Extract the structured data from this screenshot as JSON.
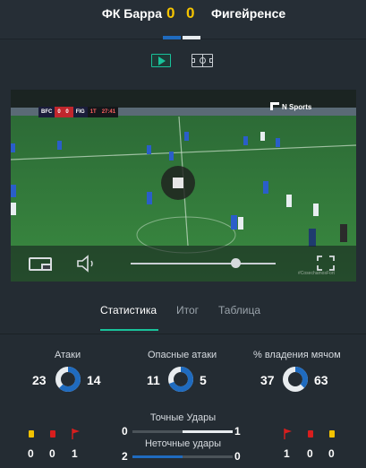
{
  "match": {
    "home_team": "ФК Барра",
    "away_team": "Фигейренсе",
    "home_score": "0",
    "away_score": "0"
  },
  "view_toggle": {
    "video_icon": "play-icon",
    "field_icon": "pitch-icon",
    "selected": "video"
  },
  "video": {
    "scoreboard": {
      "home_abbr": "BFC",
      "score": "0 0",
      "away_abbr": "FIG",
      "period": "1T",
      "clock": "27:41"
    },
    "broadcaster": "N Sports",
    "watermark": "#CosechamosFort",
    "state": "playing",
    "seek_progress": 0.72
  },
  "tabs": [
    {
      "label": "Статистика",
      "active": true
    },
    {
      "label": "Итог",
      "active": false
    },
    {
      "label": "Таблица",
      "active": false
    }
  ],
  "stats": {
    "attacks": {
      "label": "Атаки",
      "home": "23",
      "away": "14"
    },
    "dangerous_attacks": {
      "label": "Опасные атаки",
      "home": "11",
      "away": "5"
    },
    "possession": {
      "label": "% владения мячом",
      "home": "37",
      "away": "63"
    },
    "shots_on_target": {
      "label": "Точные Удары",
      "home": "0",
      "away": "1"
    },
    "shots_off_target": {
      "label": "Неточные удары",
      "home": "2",
      "away": "0"
    },
    "home_cards": {
      "yellow": "0",
      "red": "0",
      "corners": "1"
    },
    "away_cards": {
      "corners": "1",
      "red": "0",
      "yellow": "0"
    }
  },
  "colors": {
    "home": "#1f6bbf",
    "away": "#e8ecef",
    "accent": "#19c29a",
    "score": "#f5c400",
    "yellow_card": "#f2c200",
    "red_card": "#d81e1e"
  }
}
